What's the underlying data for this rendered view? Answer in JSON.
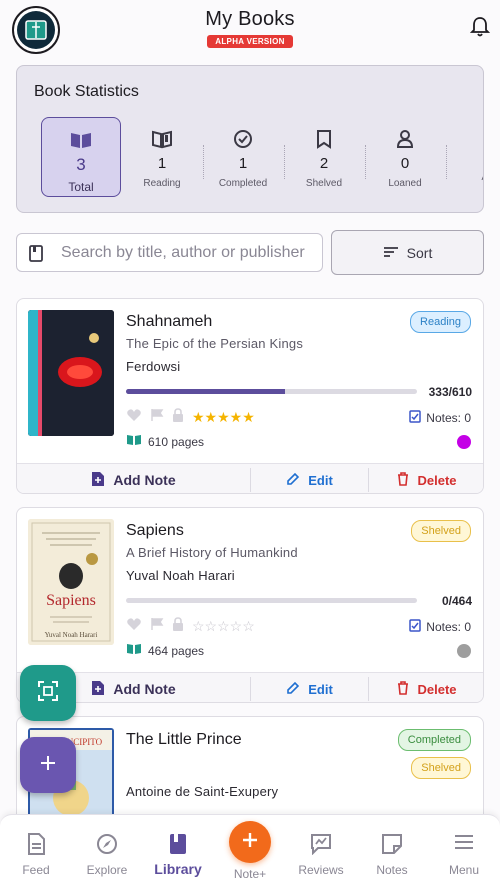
{
  "header": {
    "title": "My Books",
    "badge": "ALPHA VERSION"
  },
  "stats": {
    "title": "Book Statistics",
    "items": [
      {
        "value": "3",
        "label": "Total",
        "icon": "open-book-icon"
      },
      {
        "value": "1",
        "label": "Reading",
        "icon": "reading-book-icon"
      },
      {
        "value": "1",
        "label": "Completed",
        "icon": "check-circle-icon"
      },
      {
        "value": "2",
        "label": "Shelved",
        "icon": "bookmark-icon"
      },
      {
        "value": "0",
        "label": "Loaned",
        "icon": "person-icon"
      },
      {
        "value": "",
        "label": "Al",
        "icon": ""
      }
    ]
  },
  "search": {
    "placeholder": "Search by title, author or publisher"
  },
  "sort": {
    "label": "Sort"
  },
  "books": [
    {
      "title": "Shahnameh",
      "subtitle": "The Epic of the Persian Kings",
      "author": "Ferdowsi",
      "status": [
        "Reading"
      ],
      "progress_text": "333/610",
      "progress": 0.546,
      "rating": 5,
      "stars": "★★★★★",
      "notes": "Notes: 0",
      "pages": "610 pages",
      "color": "#c400e6",
      "actions": {
        "add_note": "Add Note",
        "edit": "Edit",
        "delete": "Delete"
      }
    },
    {
      "title": "Sapiens",
      "subtitle": "A Brief History of Humankind",
      "author": "Yuval Noah Harari",
      "status": [
        "Shelved"
      ],
      "progress_text": "0/464",
      "progress": 0,
      "rating": 0,
      "stars": "☆☆☆☆☆",
      "notes": "Notes: 0",
      "pages": "464 pages",
      "color": "#9e9e9e",
      "actions": {
        "add_note": "Add Note",
        "edit": "Edit",
        "delete": "Delete"
      }
    },
    {
      "title": "The Little Prince",
      "subtitle": "",
      "author": "Antoine de Saint-Exupery",
      "status": [
        "Completed",
        "Shelved"
      ]
    }
  ],
  "cover_text": {
    "sapiens_title": "Sapiens",
    "sapiens_author": "Yuval Noah Harari",
    "little_prince": "EL PRINCIPITO"
  },
  "nav": {
    "items": [
      "Feed",
      "Explore",
      "Library",
      "Reviews",
      "Notes",
      "Menu"
    ],
    "center": "Note+"
  },
  "colors": {
    "accent": "#5c4d9c",
    "reading_badge": "#2d82c6",
    "shelved_badge": "#d3a11a",
    "completed_badge": "#3a8d3f",
    "delete": "#d32f2f",
    "edit": "#1f6fd1",
    "note_fab": "#f26a1b",
    "scan_fab": "#1f9a8a"
  }
}
